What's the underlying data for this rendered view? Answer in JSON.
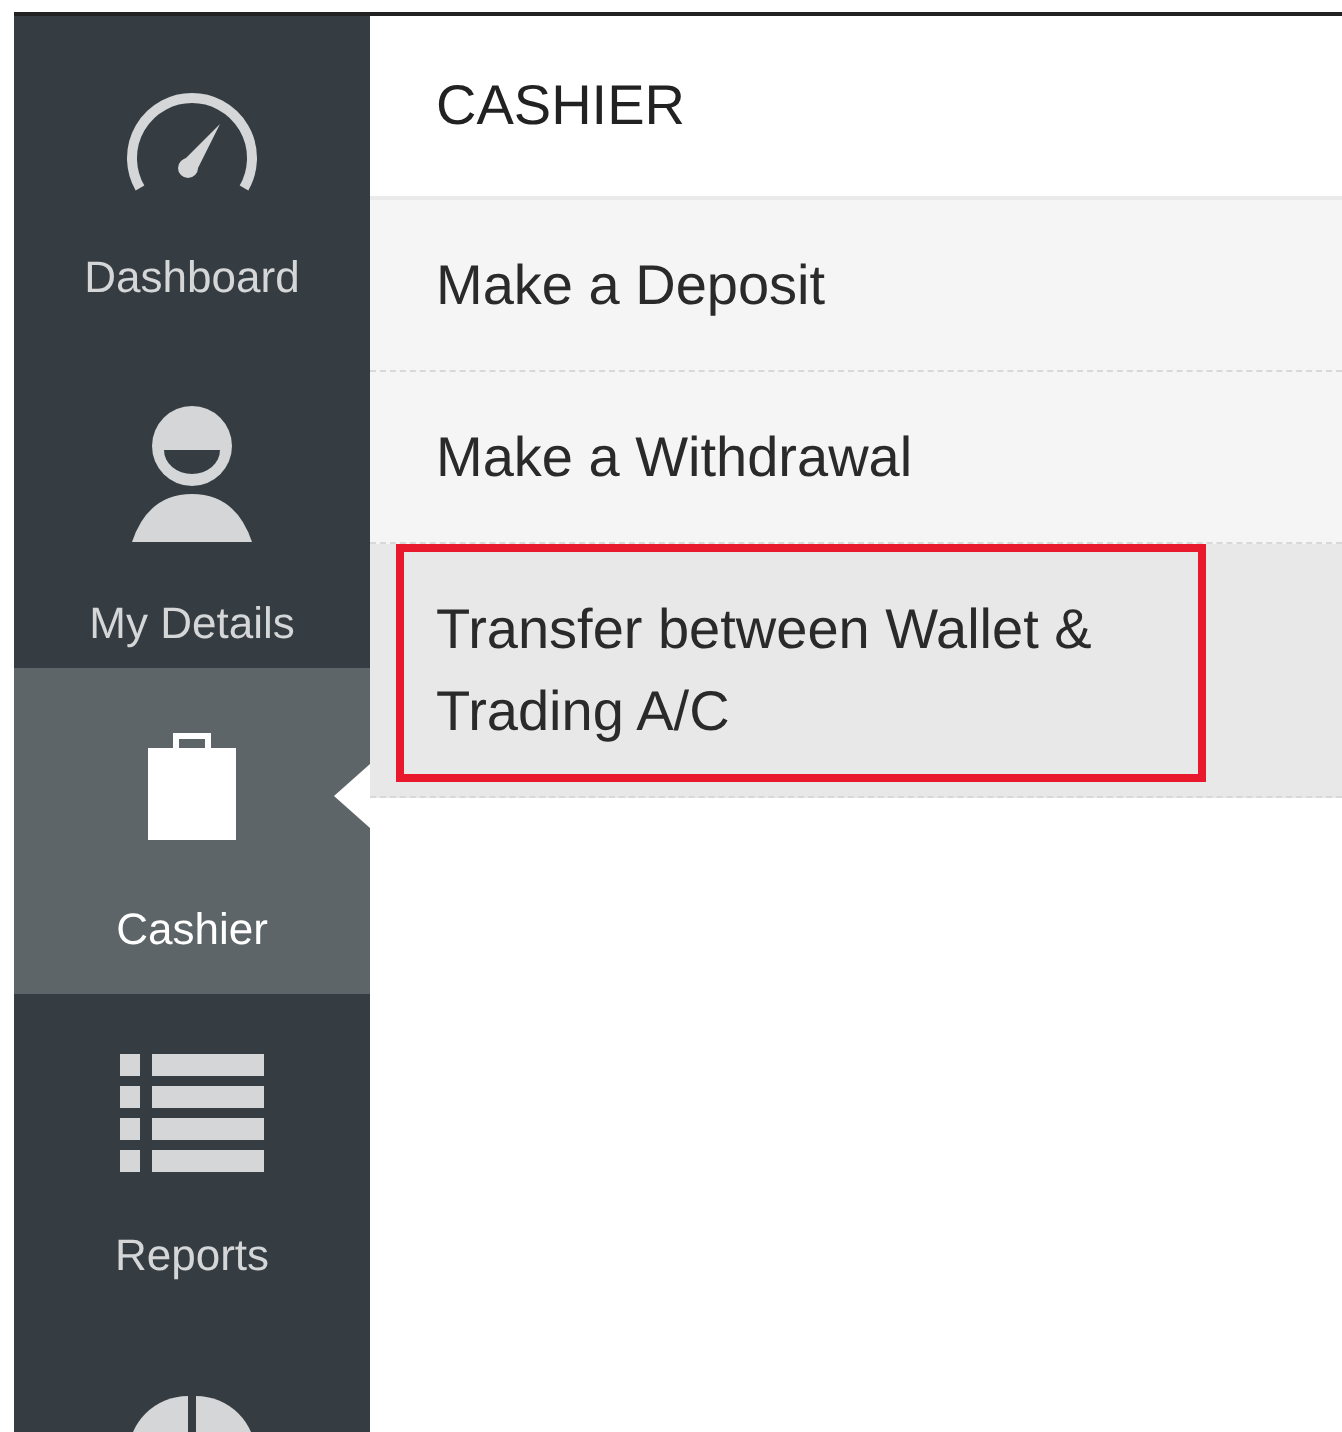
{
  "sidebar": {
    "items": [
      {
        "kind": "gauge",
        "label": "Dashboard",
        "selected": false
      },
      {
        "kind": "person",
        "label": "My Details",
        "selected": false
      },
      {
        "kind": "briefcase",
        "label": "Cashier",
        "selected": true
      },
      {
        "kind": "list",
        "label": "Reports",
        "selected": false
      },
      {
        "kind": "pie",
        "selected": false
      }
    ]
  },
  "panel": {
    "title": "CASHIER",
    "items": [
      {
        "label": "Make a Deposit",
        "selected": false,
        "highlighted": false
      },
      {
        "label": "Make a Withdrawal",
        "selected": false,
        "highlighted": false
      },
      {
        "label": "Transfer between Wallet & Trading A/C",
        "selected": true,
        "highlighted": true
      }
    ]
  }
}
